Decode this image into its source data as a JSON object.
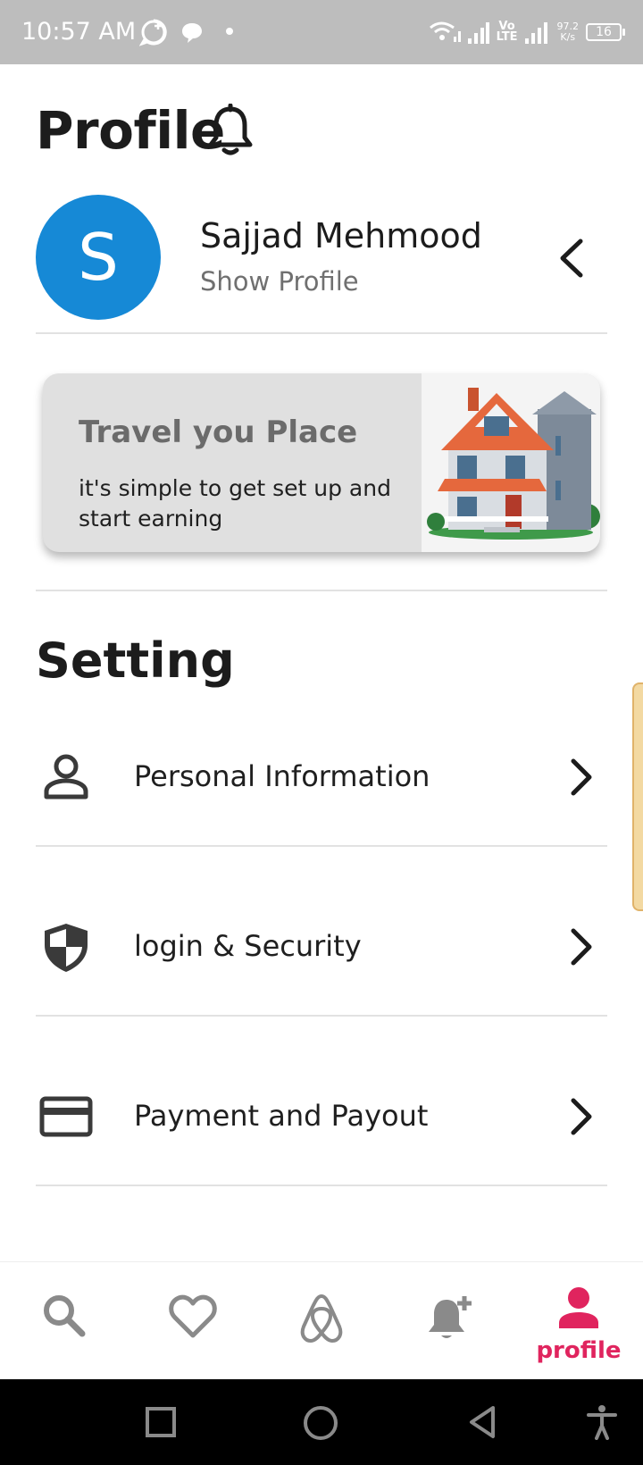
{
  "status_bar": {
    "time": "10:57 AM",
    "net_speed_value": "97.2",
    "net_speed_unit": "K/s",
    "battery": "16",
    "vo_label": "Vo",
    "lte_label": "LTE"
  },
  "header": {
    "title": "Profile"
  },
  "profile": {
    "initial": "S",
    "name": "Sajjad Mehmood",
    "subtitle": "Show Profile",
    "avatar_color": "#1689d6"
  },
  "promo": {
    "title": "Travel you Place",
    "text": "it's simple to get set up and\n start earning"
  },
  "settings": {
    "title": "Setting",
    "items": [
      {
        "label": "Personal Information",
        "icon": "person-icon"
      },
      {
        "label": "login & Security",
        "icon": "shield-icon"
      },
      {
        "label": "Payment and Payout",
        "icon": "credit-card-icon"
      }
    ]
  },
  "bottom_nav": {
    "active_label": "profile",
    "accent": "#e0245e",
    "items": [
      "search-icon",
      "heart-icon",
      "airbnb-logo-icon",
      "notification-add-icon",
      "profile-icon"
    ]
  }
}
